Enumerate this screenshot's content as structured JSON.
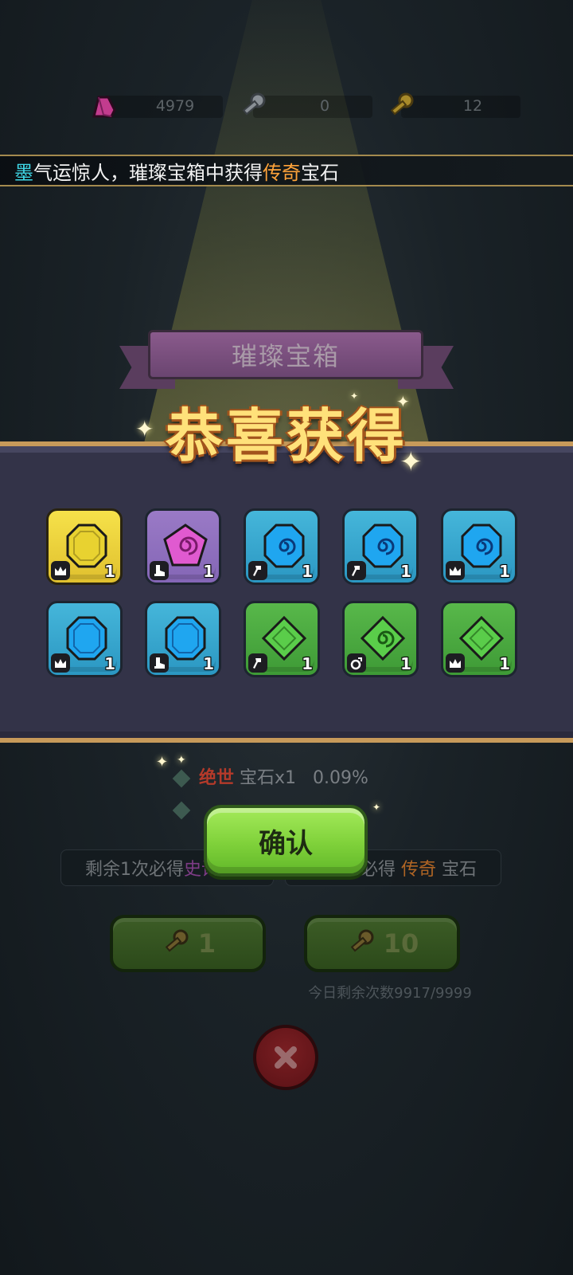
{
  "resources": [
    {
      "icon": "gem-shard-icon",
      "value": "4979"
    },
    {
      "icon": "silver-key-icon",
      "value": "0"
    },
    {
      "icon": "gold-key-icon",
      "value": "12"
    }
  ],
  "broadcast": {
    "name": "墨",
    "name_prefix": " ",
    "middle": "气运惊人，璀璨宝箱中获得",
    "highlight": "传奇",
    "suffix": "宝石"
  },
  "chest_title": "璀璨宝箱",
  "congrats_title": "恭喜获得",
  "rewards": [
    {
      "color": "gold",
      "gem": "octagon",
      "badge": "crown-icon",
      "count": "1"
    },
    {
      "color": "purple",
      "gem": "pentagon-swirl",
      "badge": "boot-icon",
      "count": "1"
    },
    {
      "color": "blue",
      "gem": "swirl",
      "badge": "axe-icon",
      "count": "1"
    },
    {
      "color": "blue",
      "gem": "swirl",
      "badge": "axe-icon",
      "count": "1"
    },
    {
      "color": "blue",
      "gem": "swirl",
      "badge": "crown-icon",
      "count": "1"
    },
    {
      "color": "blue",
      "gem": "octagon",
      "badge": "crown-icon",
      "count": "1"
    },
    {
      "color": "blue",
      "gem": "octagon",
      "badge": "boot-icon",
      "count": "1"
    },
    {
      "color": "green",
      "gem": "diamond",
      "badge": "axe-icon",
      "count": "1"
    },
    {
      "color": "green",
      "gem": "diamond-swirl",
      "badge": "ring-icon",
      "count": "1"
    },
    {
      "color": "green",
      "gem": "diamond",
      "badge": "crown-icon",
      "count": "1"
    }
  ],
  "odds": [
    {
      "rarity": "绝世",
      "text": "宝石x1",
      "percent": "0.09%"
    }
  ],
  "guarantee": {
    "left_prefix": "剩余1次必得",
    "left_rarity": "史诗",
    "right_prefix": "次必得",
    "right_rarity": "传奇",
    "right_suffix": "宝石"
  },
  "confirm_label": "确认",
  "draw_buttons": [
    {
      "icon": "gold-key-icon",
      "count": "1"
    },
    {
      "icon": "gold-key-icon",
      "count": "10"
    }
  ],
  "today_remaining": "今日剩余次数9917/9999",
  "colors": {
    "gold_tile": "#f6e24a",
    "purple_tile": "#9a7ac6",
    "blue_tile": "#45b6da",
    "green_tile": "#58b84a",
    "confirm_green": "#7fd13a",
    "legendary_orange": "#ffa33a"
  }
}
